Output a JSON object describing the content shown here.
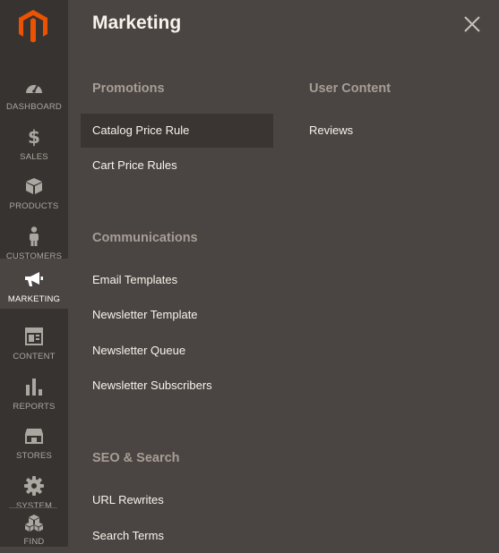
{
  "colors": {
    "sidebar_bg": "#373330",
    "panel_bg": "#4a4542",
    "logo_orange": "#eb5202",
    "section_title": "#a79d95",
    "link_text": "#f7f3eb",
    "nav_text": "#aaa6a0",
    "hover_bg": "#3a3532"
  },
  "sidebar": {
    "logo_icon": "magento-logo-icon",
    "items": [
      {
        "label": "DASHBOARD",
        "icon": "dashboard-gauge-icon"
      },
      {
        "label": "SALES",
        "icon": "dollar-icon"
      },
      {
        "label": "PRODUCTS",
        "icon": "box-icon"
      },
      {
        "label": "CUSTOMERS",
        "icon": "person-icon"
      },
      {
        "label": "MARKETING",
        "icon": "megaphone-icon",
        "active": true
      },
      {
        "label": "CONTENT",
        "icon": "layout-icon"
      },
      {
        "label": "REPORTS",
        "icon": "bar-chart-icon"
      },
      {
        "label": "STORES",
        "icon": "storefront-icon"
      },
      {
        "label": "SYSTEM",
        "icon": "gear-icon"
      },
      {
        "label": "FIND PARTNERS",
        "icon": "cubes-icon"
      }
    ]
  },
  "panel": {
    "title": "Marketing",
    "close_icon": "close-icon",
    "sections": {
      "promotions": {
        "title": "Promotions",
        "links": [
          "Catalog Price Rule",
          "Cart Price Rules"
        ]
      },
      "user_content": {
        "title": "User Content",
        "links": [
          "Reviews"
        ]
      },
      "communications": {
        "title": "Communications",
        "links": [
          "Email Templates",
          "Newsletter Template",
          "Newsletter Queue",
          "Newsletter Subscribers"
        ]
      },
      "seo": {
        "title": "SEO & Search",
        "links": [
          "URL Rewrites",
          "Search Terms"
        ]
      }
    }
  }
}
